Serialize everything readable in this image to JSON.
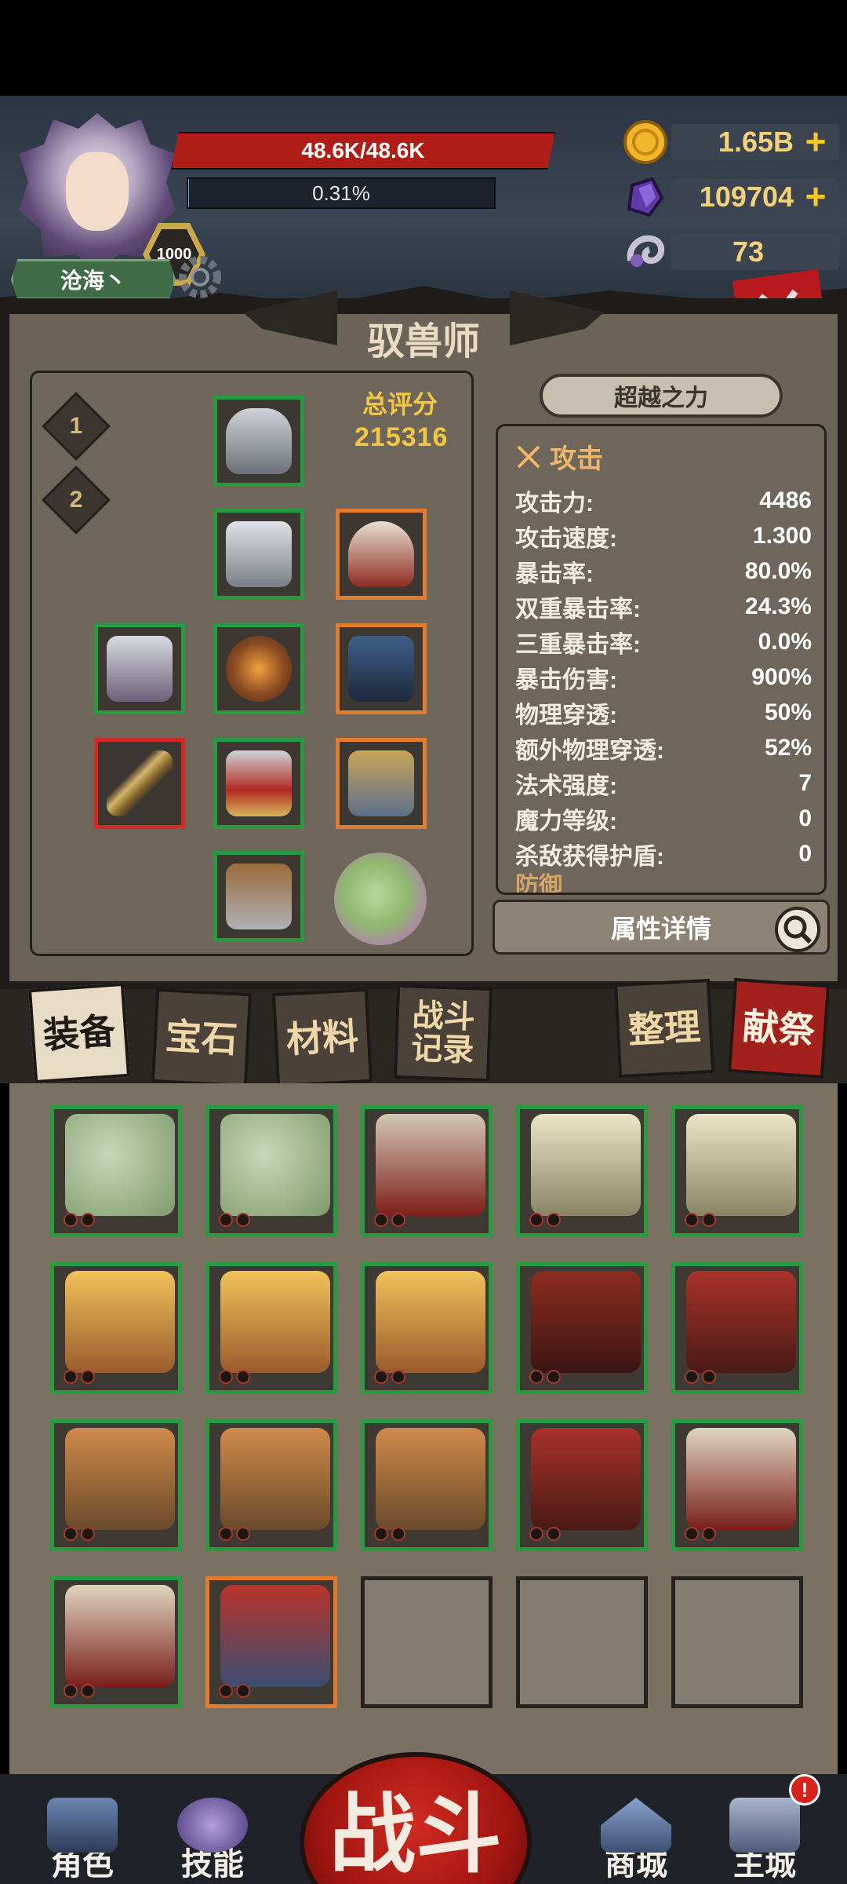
{
  "player": {
    "name": "沧海丶",
    "level": "1000",
    "hp_text": "48.6K/48.6K",
    "exp_text": "0.31%",
    "exp_fraction": 0.0031
  },
  "resources": {
    "gold": "1.65B",
    "gems": "109704",
    "horns": "73"
  },
  "panel": {
    "class_title": "驭兽师",
    "set_tabs": [
      "1",
      "2"
    ],
    "total_score_label": "总评分",
    "total_score": "215316",
    "transcend_button": "超越之力",
    "attr_detail_button": "属性详情"
  },
  "stats": {
    "section": "攻击",
    "rows": [
      {
        "label": "攻击力:",
        "value": "4486"
      },
      {
        "label": "攻击速度:",
        "value": "1.300"
      },
      {
        "label": "暴击率:",
        "value": "80.0%"
      },
      {
        "label": "双重暴击率:",
        "value": "24.3%"
      },
      {
        "label": "三重暴击率:",
        "value": "0.0%"
      },
      {
        "label": "暴击伤害:",
        "value": "900%"
      },
      {
        "label": "物理穿透:",
        "value": "50%"
      },
      {
        "label": "额外物理穿透:",
        "value": "52%"
      },
      {
        "label": "法术强度:",
        "value": "7"
      },
      {
        "label": "魔力等级:",
        "value": "0"
      },
      {
        "label": "杀敌获得护盾:",
        "value": "0"
      }
    ],
    "next_section_partial": "防御"
  },
  "tabs": {
    "equipment": "装备",
    "gems": "宝石",
    "materials": "材料",
    "battle_log": "战斗记录",
    "sort": "整理",
    "sacrifice": "献祭"
  },
  "nav": {
    "character": "角色",
    "skills": "技能",
    "battle": "战斗",
    "shop": "商城",
    "main_city": "主城",
    "alert": "!"
  },
  "colors": {
    "hp_red": "#b01c16",
    "gold": "#f2c744",
    "rarity_green": "#2a9a42",
    "rarity_orange": "#e27d2f",
    "rarity_red": "#d22a24"
  }
}
